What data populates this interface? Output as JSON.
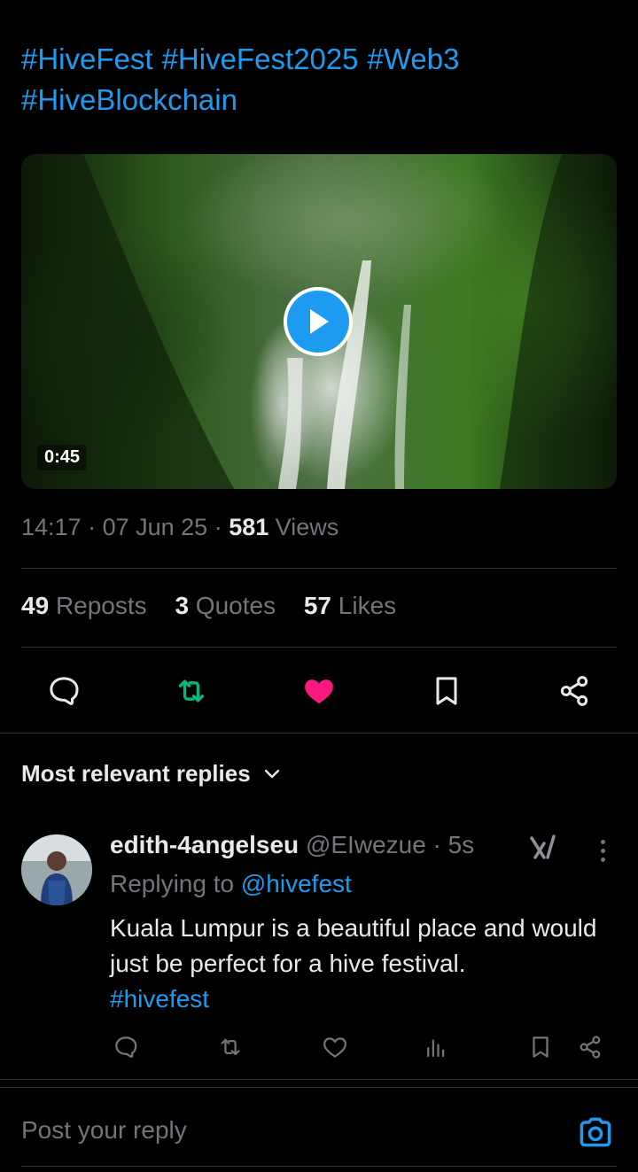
{
  "post": {
    "hashtags": [
      "#HiveFest",
      "#HiveFest2025",
      "#Web3",
      "#HiveBlockchain"
    ],
    "video_duration": "0:45",
    "time": "14:17",
    "date": "07 Jun 25",
    "views_count": "581",
    "views_label": "Views",
    "reposts_count": "49",
    "reposts_label": "Reposts",
    "quotes_count": "3",
    "quotes_label": "Quotes",
    "likes_count": "57",
    "likes_label": "Likes"
  },
  "actions": {
    "reply_icon": "reply-icon",
    "repost_icon": "repost-icon",
    "like_icon": "heart-filled-icon",
    "bookmark_icon": "bookmark-icon",
    "share_icon": "share-icon",
    "repost_color": "#00ba7c",
    "like_color": "#f91880"
  },
  "replies_filter": {
    "label": "Most relevant replies"
  },
  "reply": {
    "display_name": "edith-4angelseu",
    "handle": "@EIwezue",
    "time": "5s",
    "replying_to_label": "Replying to",
    "replying_to_handle": "@hivefest",
    "text": "Kuala Lumpur is a beautiful place and would just be perfect for a hive festival.",
    "hashtag": "#hivefest"
  },
  "composer": {
    "placeholder": "Post your reply"
  },
  "colors": {
    "accent": "#1d9bf0",
    "muted": "#71767b",
    "background": "#000000"
  }
}
